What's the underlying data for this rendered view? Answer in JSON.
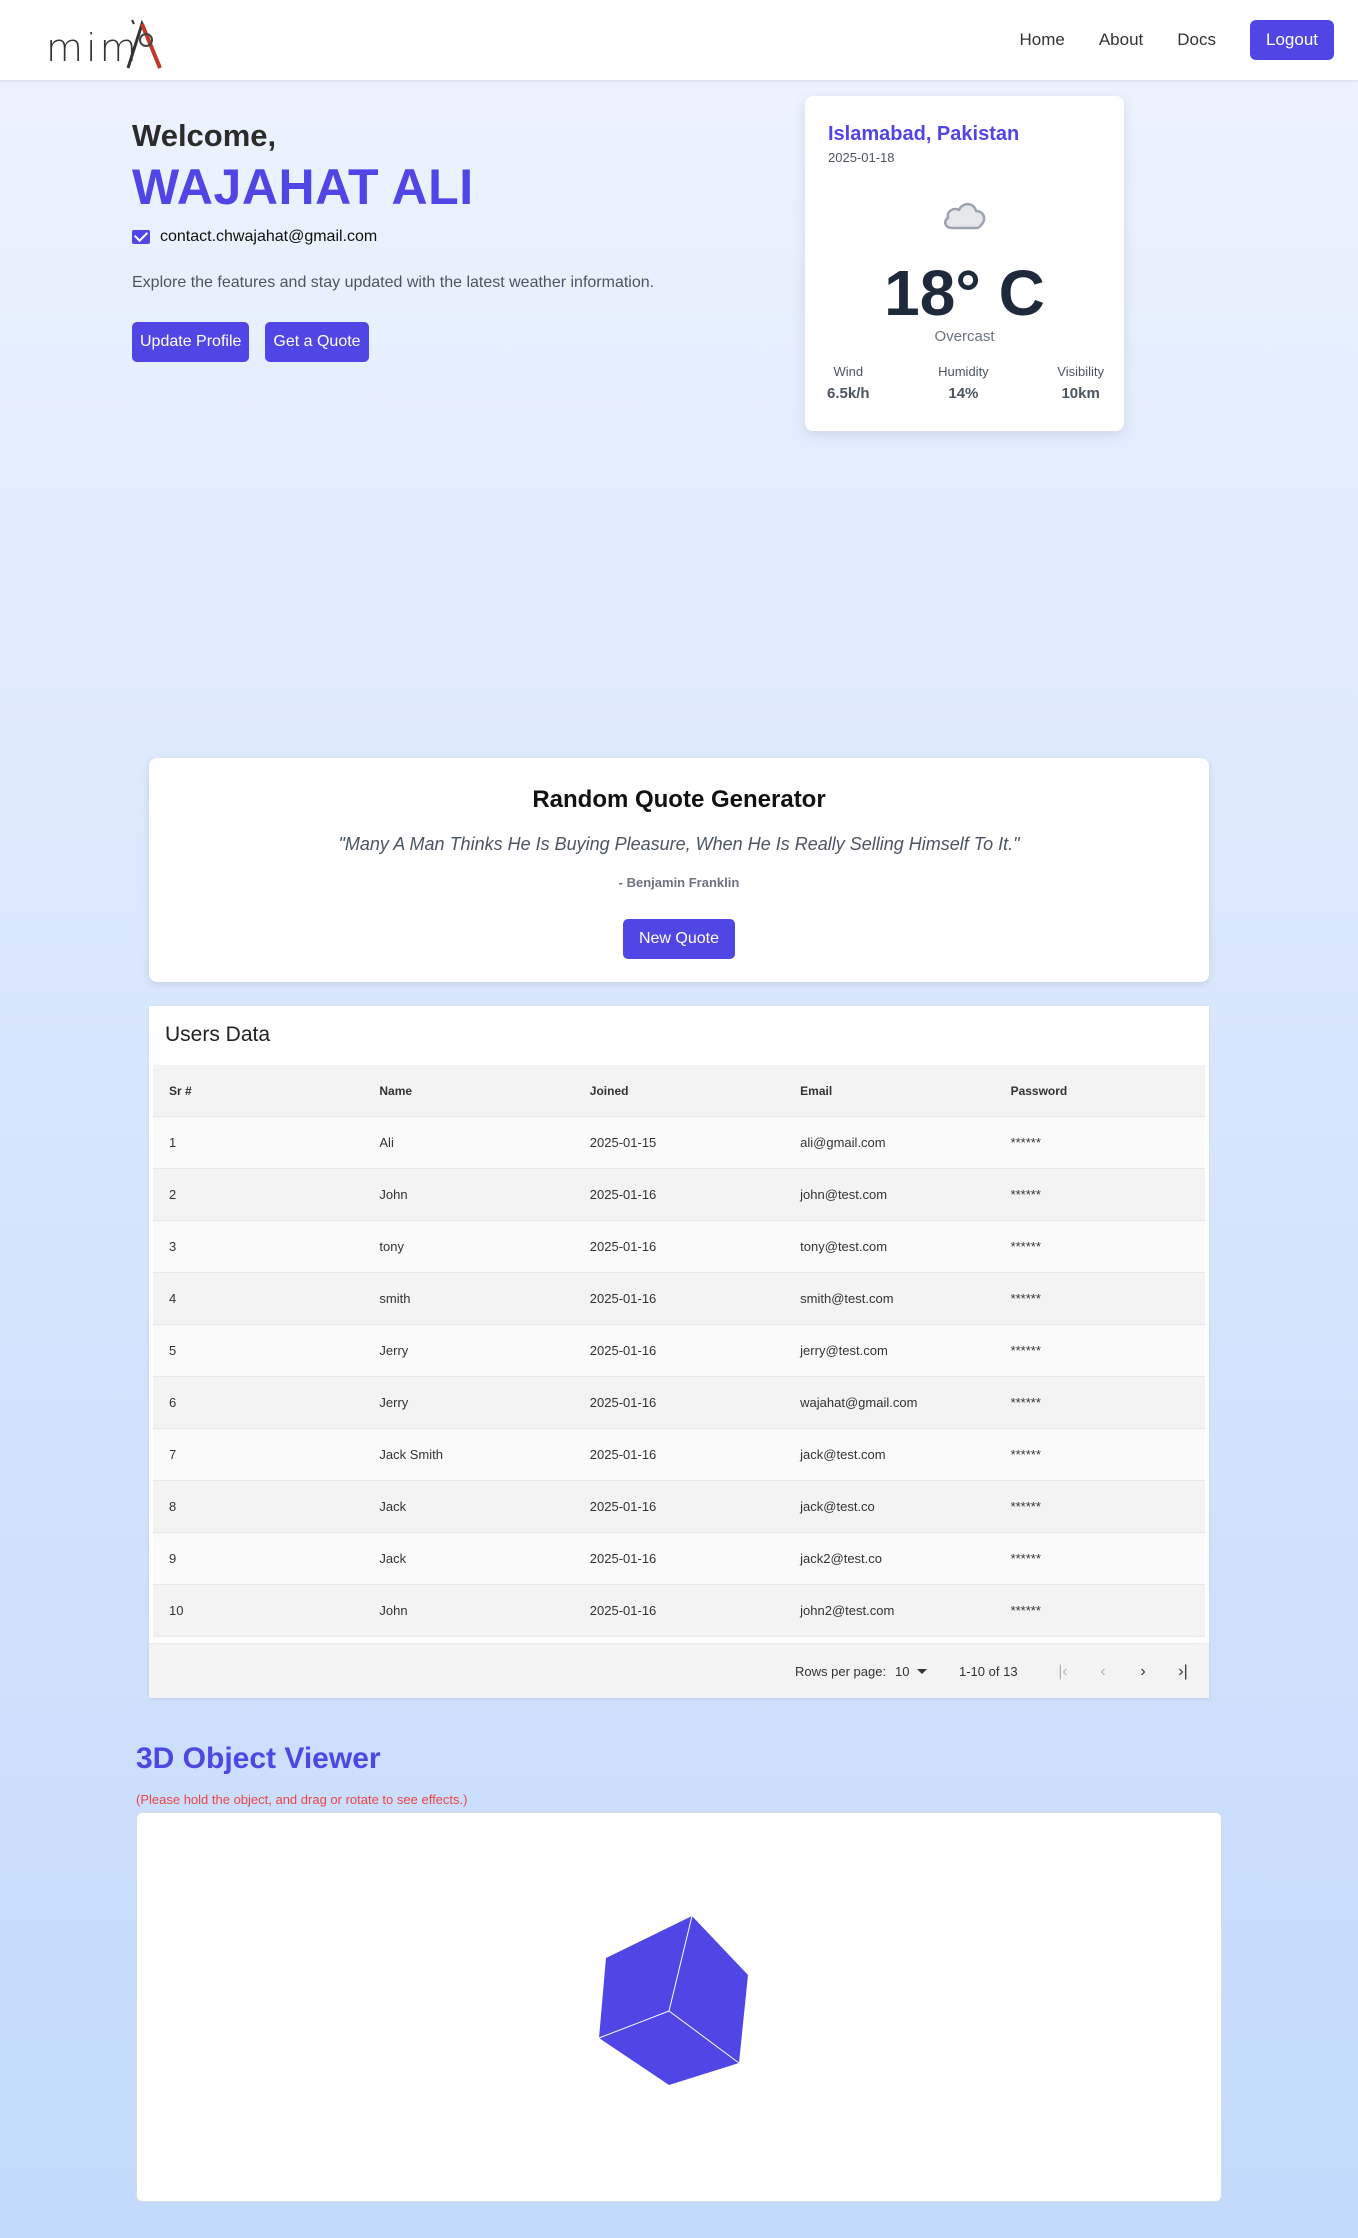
{
  "nav": {
    "logo_text": "mim",
    "links": [
      "Home",
      "About",
      "Docs"
    ],
    "logout_label": "Logout"
  },
  "welcome": {
    "greeting": "Welcome,",
    "name": "WAJAHAT ALI",
    "email": "contact.chwajahat@gmail.com",
    "tagline": "Explore the features and stay updated with the latest weather information.",
    "update_profile_label": "Update Profile",
    "get_quote_label": "Get a Quote"
  },
  "weather": {
    "city": "Islamabad, Pakistan",
    "date": "2025-01-18",
    "temperature": "18° C",
    "condition": "Overcast",
    "stats": [
      {
        "label": "Wind",
        "value": "6.5k/h"
      },
      {
        "label": "Humidity",
        "value": "14%"
      },
      {
        "label": "Visibility",
        "value": "10km"
      }
    ]
  },
  "quote": {
    "title": "Random Quote Generator",
    "text": "\"Many A Man Thinks He Is Buying Pleasure, When He Is Really Selling Himself To It.\"",
    "author": "- Benjamin Franklin",
    "button_label": "New Quote"
  },
  "users_table": {
    "title": "Users Data",
    "columns": [
      "Sr #",
      "Name",
      "Joined",
      "Email",
      "Password"
    ],
    "rows": [
      [
        "1",
        "Ali",
        "2025-01-15",
        "ali@gmail.com",
        "******"
      ],
      [
        "2",
        "John",
        "2025-01-16",
        "john@test.com",
        "******"
      ],
      [
        "3",
        "tony",
        "2025-01-16",
        "tony@test.com",
        "******"
      ],
      [
        "4",
        "smith",
        "2025-01-16",
        "smith@test.com",
        "******"
      ],
      [
        "5",
        "Jerry",
        "2025-01-16",
        "jerry@test.com",
        "******"
      ],
      [
        "6",
        "Jerry",
        "2025-01-16",
        "wajahat@gmail.com",
        "******"
      ],
      [
        "7",
        "Jack Smith",
        "2025-01-16",
        "jack@test.com",
        "******"
      ],
      [
        "8",
        "Jack",
        "2025-01-16",
        "jack@test.co",
        "******"
      ],
      [
        "9",
        "Jack",
        "2025-01-16",
        "jack2@test.co",
        "******"
      ],
      [
        "10",
        "John",
        "2025-01-16",
        "john2@test.com",
        "******"
      ]
    ],
    "footer": {
      "rows_per_page_label": "Rows per page:",
      "rows_per_page_value": "10",
      "range": "1-10 of 13"
    }
  },
  "viewer": {
    "title": "3D Object Viewer",
    "hint": "(Please hold the object, and drag or rotate to see effects.)",
    "cube_color": "#4f46e5"
  },
  "colors": {
    "accent": "#4f46e5",
    "hint_red": "#ef4444"
  }
}
